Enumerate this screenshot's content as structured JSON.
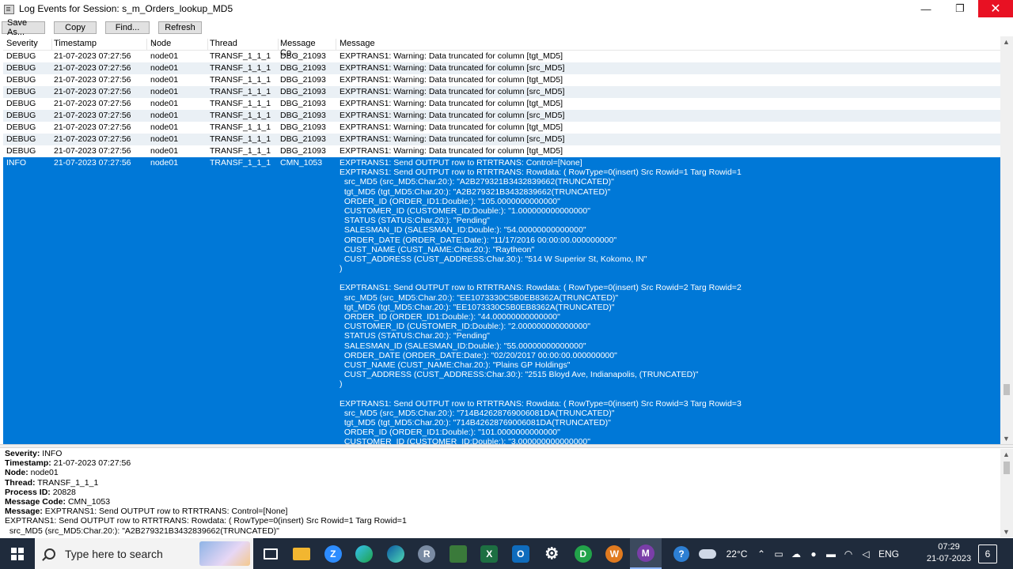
{
  "window": {
    "title": "Log Events for Session: s_m_Orders_lookup_MD5",
    "minimize": "—",
    "maximize": "❐",
    "close": "✕"
  },
  "toolbar": {
    "save_as": "Save As...",
    "copy": "Copy",
    "find": "Find...",
    "refresh": "Refresh"
  },
  "columns": {
    "severity": "Severity",
    "timestamp": "Timestamp",
    "sort_indicator": "/",
    "node": "Node",
    "thread": "Thread",
    "message_code": "Message Co...",
    "message": "Message"
  },
  "rows": [
    {
      "severity": "DEBUG",
      "timestamp": "21-07-2023 07:27:56",
      "node": "node01",
      "thread": "TRANSF_1_1_1",
      "code": "DBG_21093",
      "message": "EXPTRANS1: Warning: Data truncated for column [tgt_MD5]"
    },
    {
      "severity": "DEBUG",
      "timestamp": "21-07-2023 07:27:56",
      "node": "node01",
      "thread": "TRANSF_1_1_1",
      "code": "DBG_21093",
      "message": "EXPTRANS1: Warning: Data truncated for column [src_MD5]"
    },
    {
      "severity": "DEBUG",
      "timestamp": "21-07-2023 07:27:56",
      "node": "node01",
      "thread": "TRANSF_1_1_1",
      "code": "DBG_21093",
      "message": "EXPTRANS1: Warning: Data truncated for column [tgt_MD5]"
    },
    {
      "severity": "DEBUG",
      "timestamp": "21-07-2023 07:27:56",
      "node": "node01",
      "thread": "TRANSF_1_1_1",
      "code": "DBG_21093",
      "message": "EXPTRANS1: Warning: Data truncated for column [src_MD5]"
    },
    {
      "severity": "DEBUG",
      "timestamp": "21-07-2023 07:27:56",
      "node": "node01",
      "thread": "TRANSF_1_1_1",
      "code": "DBG_21093",
      "message": "EXPTRANS1: Warning: Data truncated for column [tgt_MD5]"
    },
    {
      "severity": "DEBUG",
      "timestamp": "21-07-2023 07:27:56",
      "node": "node01",
      "thread": "TRANSF_1_1_1",
      "code": "DBG_21093",
      "message": "EXPTRANS1: Warning: Data truncated for column [src_MD5]"
    },
    {
      "severity": "DEBUG",
      "timestamp": "21-07-2023 07:27:56",
      "node": "node01",
      "thread": "TRANSF_1_1_1",
      "code": "DBG_21093",
      "message": "EXPTRANS1: Warning: Data truncated for column [tgt_MD5]"
    },
    {
      "severity": "DEBUG",
      "timestamp": "21-07-2023 07:27:56",
      "node": "node01",
      "thread": "TRANSF_1_1_1",
      "code": "DBG_21093",
      "message": "EXPTRANS1: Warning: Data truncated for column [src_MD5]"
    },
    {
      "severity": "DEBUG",
      "timestamp": "21-07-2023 07:27:56",
      "node": "node01",
      "thread": "TRANSF_1_1_1",
      "code": "DBG_21093",
      "message": "EXPTRANS1: Warning: Data truncated for column [tgt_MD5]"
    }
  ],
  "selected_row": {
    "severity": "INFO",
    "timestamp": "21-07-2023 07:27:56",
    "node": "node01",
    "thread": "TRANSF_1_1_1",
    "code": "CMN_1053",
    "message_lines": [
      "EXPTRANS1: Send OUTPUT row to RTRTRANS: Control=[None]",
      "EXPTRANS1: Send OUTPUT row to RTRTRANS: Rowdata: ( RowType=0(insert) Src Rowid=1 Targ Rowid=1",
      "  src_MD5 (src_MD5:Char.20:): \"A2B279321B3432839662(TRUNCATED)\"",
      "  tgt_MD5 (tgt_MD5:Char.20:): \"A2B279321B3432839662(TRUNCATED)\"",
      "  ORDER_ID (ORDER_ID1:Double:): \"105.0000000000000\"",
      "  CUSTOMER_ID (CUSTOMER_ID:Double:): \"1.000000000000000\"",
      "  STATUS (STATUS:Char.20:): \"Pending\"",
      "  SALESMAN_ID (SALESMAN_ID:Double:): \"54.00000000000000\"",
      "  ORDER_DATE (ORDER_DATE:Date:): \"11/17/2016 00:00:00.000000000\"",
      "  CUST_NAME (CUST_NAME:Char.20:): \"Raytheon\"",
      "  CUST_ADDRESS (CUST_ADDRESS:Char.30:): \"514 W Superior St, Kokomo, IN\"",
      ")",
      "",
      "EXPTRANS1: Send OUTPUT row to RTRTRANS: Rowdata: ( RowType=0(insert) Src Rowid=2 Targ Rowid=2",
      "  src_MD5 (src_MD5:Char.20:): \"EE1073330C5B0EB8362A(TRUNCATED)\"",
      "  tgt_MD5 (tgt_MD5:Char.20:): \"EE1073330C5B0EB8362A(TRUNCATED)\"",
      "  ORDER_ID (ORDER_ID1:Double:): \"44.00000000000000\"",
      "  CUSTOMER_ID (CUSTOMER_ID:Double:): \"2.000000000000000\"",
      "  STATUS (STATUS:Char.20:): \"Pending\"",
      "  SALESMAN_ID (SALESMAN_ID:Double:): \"55.00000000000000\"",
      "  ORDER_DATE (ORDER_DATE:Date:): \"02/20/2017 00:00:00.000000000\"",
      "  CUST_NAME (CUST_NAME:Char.20:): \"Plains GP Holdings\"",
      "  CUST_ADDRESS (CUST_ADDRESS:Char.30:): \"2515 Bloyd Ave, Indianapolis, (TRUNCATED)\"",
      ")",
      "",
      "EXPTRANS1: Send OUTPUT row to RTRTRANS: Rowdata: ( RowType=0(insert) Src Rowid=3 Targ Rowid=3",
      "  src_MD5 (src_MD5:Char.20:): \"714B42628769006081DA(TRUNCATED)\"",
      "  tgt_MD5 (tgt_MD5:Char.20:): \"714B42628769006081DA(TRUNCATED)\"",
      "  ORDER_ID (ORDER_ID1:Double:): \"101.0000000000000\"",
      "  CUSTOMER_ID (CUSTOMER_ID:Double:): \"3.000000000000000\""
    ]
  },
  "details": {
    "severity_label": "Severity:",
    "severity": "INFO",
    "timestamp_label": "Timestamp:",
    "timestamp": "21-07-2023 07:27:56",
    "node_label": "Node:",
    "node": "node01",
    "thread_label": "Thread:",
    "thread": "TRANSF_1_1_1",
    "pid_label": "Process ID:",
    "pid": "20828",
    "code_label": "Message Code:",
    "code": "CMN_1053",
    "message_label": "Message:",
    "message": "EXPTRANS1: Send OUTPUT row to RTRTRANS: Control=[None]",
    "extra_lines": [
      "EXPTRANS1: Send OUTPUT row to RTRTRANS: Rowdata: ( RowType=0(insert) Src Rowid=1 Targ Rowid=1",
      "  src_MD5 (src_MD5:Char.20:): \"A2B279321B3432839662(TRUNCATED)\""
    ]
  },
  "taskbar": {
    "search_placeholder": "Type here to search",
    "temperature": "22°C",
    "language": "ENG",
    "time": "07:29",
    "date": "21-07-2023",
    "notifications": "6",
    "colors": {
      "bg": "#1f2b3c",
      "selection": "#0078d7",
      "close": "#e81123"
    }
  }
}
